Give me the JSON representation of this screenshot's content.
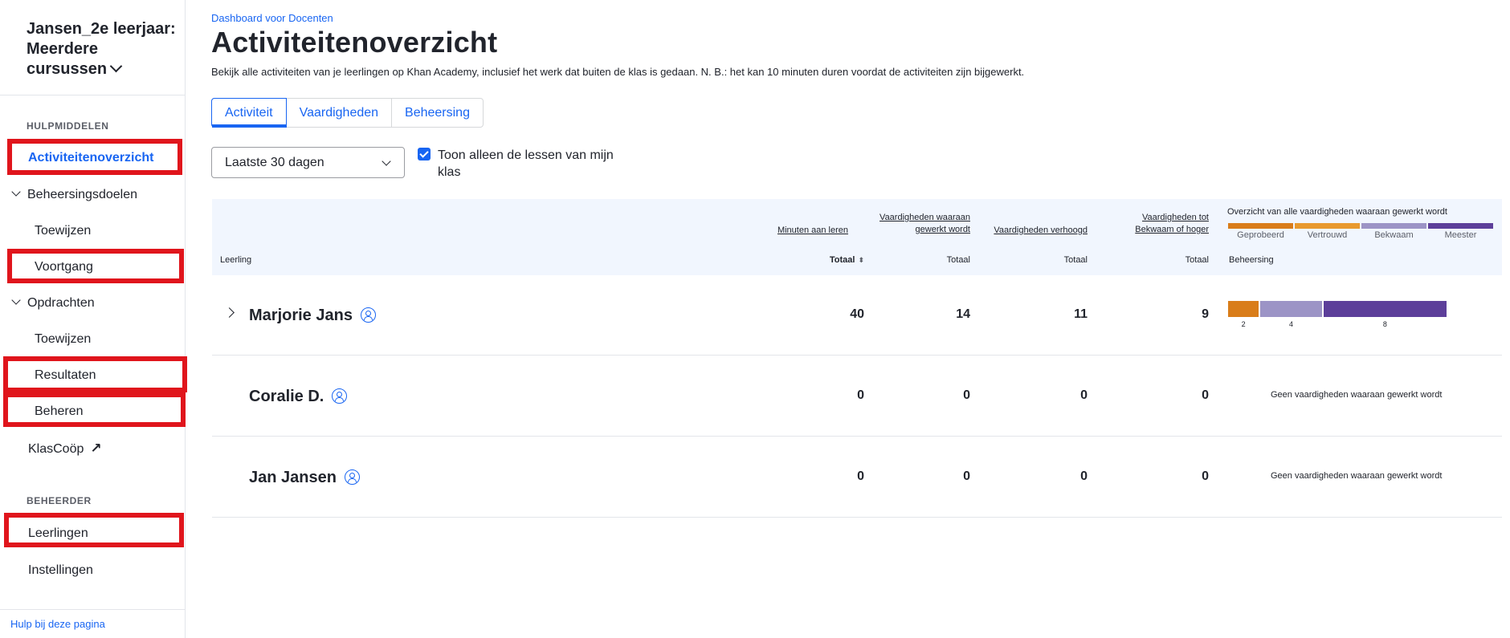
{
  "sidebar": {
    "class_title": "Jansen_2e leerjaar: Meerdere cursussen",
    "section_resources": "HULPMIDDELEN",
    "section_admin": "BEHEERDER",
    "items": {
      "activity_overview": "Activiteitenoverzicht",
      "mastery_goals": "Beheersingsdoelen",
      "mastery_assign": "Toewijzen",
      "progress": "Voortgang",
      "assignments": "Opdrachten",
      "assignments_assign": "Toewijzen",
      "results": "Resultaten",
      "manage": "Beheren",
      "klascoop": "KlasCoöp",
      "students": "Leerlingen",
      "settings": "Instellingen"
    },
    "help_link": "Hulp bij deze pagina"
  },
  "header": {
    "breadcrumb": "Dashboard voor Docenten",
    "title": "Activiteitenoverzicht",
    "description": "Bekijk alle activiteiten van je leerlingen op Khan Academy, inclusief het werk dat buiten de klas is gedaan. N. B.: het kan 10 minuten duren voordat de activiteiten zijn bijgewerkt."
  },
  "tabs": [
    "Activiteit",
    "Vaardigheden",
    "Beheersing"
  ],
  "filters": {
    "period": "Laatste 30 dagen",
    "only_my_lessons": "Toon alleen de lessen van mijn klas",
    "only_my_lessons_checked": true
  },
  "table": {
    "student_col": "Leerling",
    "columns": [
      {
        "header": "Minuten aan leren",
        "sub": "Totaal"
      },
      {
        "header": "Vaardigheden waaraan gewerkt wordt",
        "sub": "Totaal"
      },
      {
        "header": "Vaardigheden verhoogd",
        "sub": "Totaal"
      },
      {
        "header": "Vaardigheden tot Bekwaam of hoger",
        "sub": "Totaal"
      }
    ],
    "overview_title": "Overzicht van alle vaardigheden waaraan gewerkt wordt",
    "mastery_sub": "Beheersing",
    "legend": [
      {
        "label": "Geprobeerd",
        "color": "#d97d1a"
      },
      {
        "label": "Vertrouwd",
        "color": "#e89a2e"
      },
      {
        "label": "Bekwaam",
        "color": "#9c94c6"
      },
      {
        "label": "Meester",
        "color": "#5d3f9a"
      }
    ],
    "rows": [
      {
        "name": "Marjorie Jans",
        "minutes": "40",
        "worked": "14",
        "raised": "11",
        "proficient": "9",
        "mastery": [
          {
            "level": "Geprobeerd",
            "count": 2,
            "label": "2",
            "color": "#d97d1a"
          },
          {
            "level": "Bekwaam",
            "count": 4,
            "label": "4",
            "color": "#9c94c6"
          },
          {
            "level": "Meester",
            "count": 8,
            "label": "8",
            "color": "#5d3f9a"
          }
        ]
      },
      {
        "name": "Coralie D.",
        "minutes": "0",
        "worked": "0",
        "raised": "0",
        "proficient": "0",
        "no_skills": "Geen vaardigheden waaraan gewerkt wordt"
      },
      {
        "name": "Jan Jansen",
        "minutes": "0",
        "worked": "0",
        "raised": "0",
        "proficient": "0",
        "no_skills": "Geen vaardigheden waaraan gewerkt wordt"
      }
    ]
  }
}
